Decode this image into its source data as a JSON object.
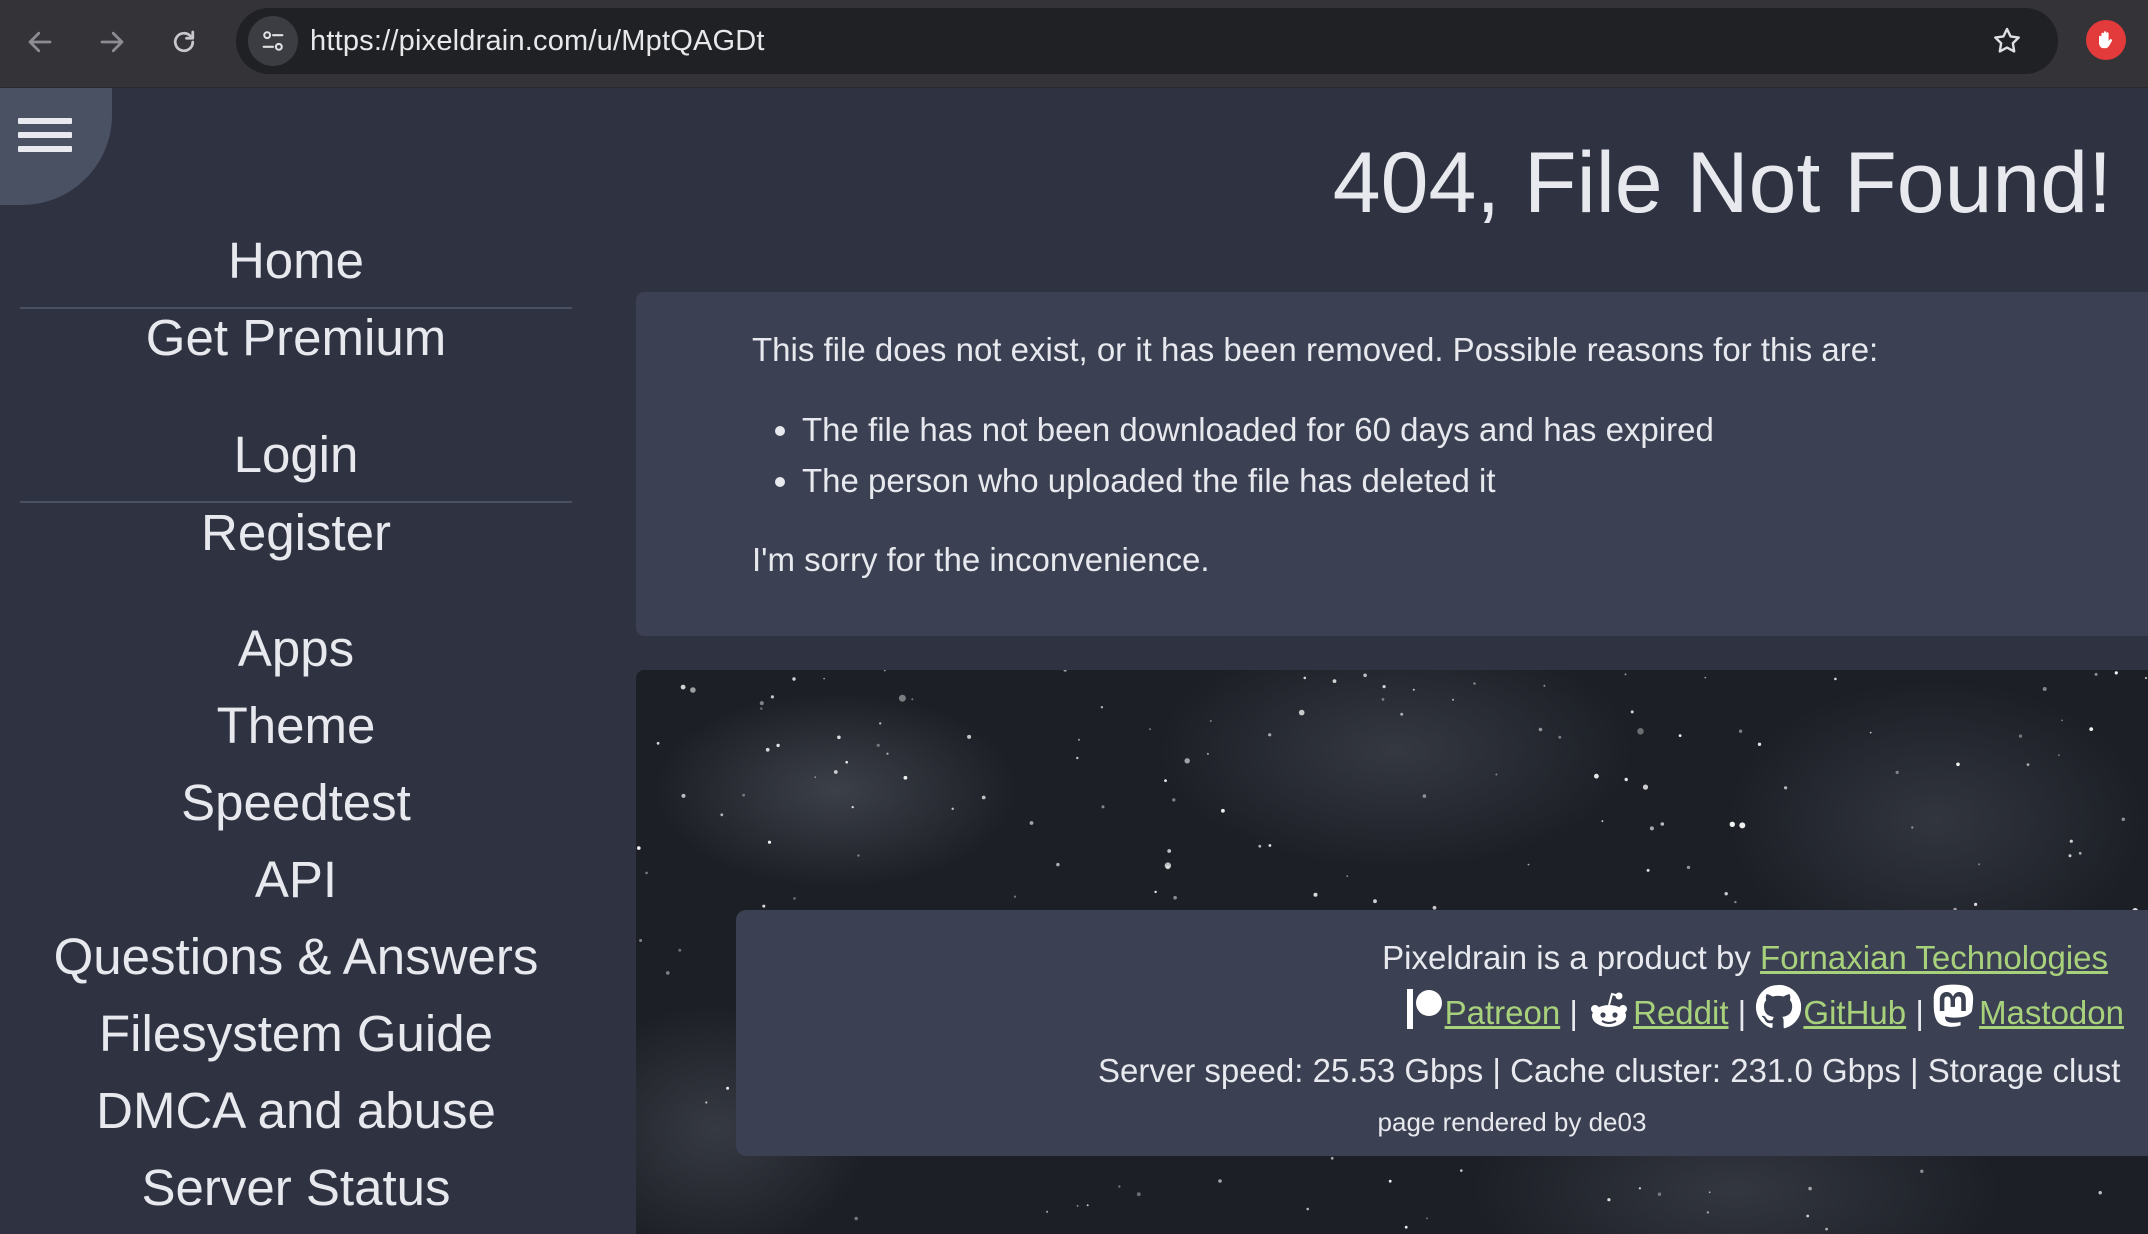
{
  "browser": {
    "url": "https://pixeldrain.com/u/MptQAGDt",
    "icons": [
      "back-arrow-icon",
      "forward-arrow-icon",
      "reload-icon",
      "site-settings-icon",
      "bookmark-star-icon",
      "extension-stop-hand-icon"
    ]
  },
  "sidebar": {
    "group1": [
      "Home",
      "Get Premium"
    ],
    "group2": [
      "Login",
      "Register"
    ],
    "group3": [
      "Apps",
      "Theme",
      "Speedtest",
      "API",
      "Questions & Answers",
      "Filesystem Guide",
      "DMCA and abuse",
      "Server Status"
    ]
  },
  "main": {
    "title": "404, File Not Found!",
    "intro": "This file does not exist, or it has been removed. Possible reasons for this are:",
    "reasons": [
      "The file has not been downloaded for 60 days and has expired",
      "The person who uploaded the file has deleted it"
    ],
    "apology": "I'm sorry for the inconvenience."
  },
  "footer": {
    "product_prefix": "Pixeldrain is a product by",
    "company": "Fornaxian Technologies",
    "links": {
      "patreon": "Patreon",
      "reddit": "Reddit",
      "github": "GitHub",
      "mastodon": "Mastodon"
    },
    "separator": "|",
    "stats": "Server speed: 25.53 Gbps | Cache cluster: 231.0 Gbps | Storage clust",
    "rendered_by": "page rendered by de03"
  },
  "colors": {
    "background": "#2f3341",
    "card": "#3b4052",
    "link": "#a8d17c",
    "text": "#e7e9ee"
  }
}
